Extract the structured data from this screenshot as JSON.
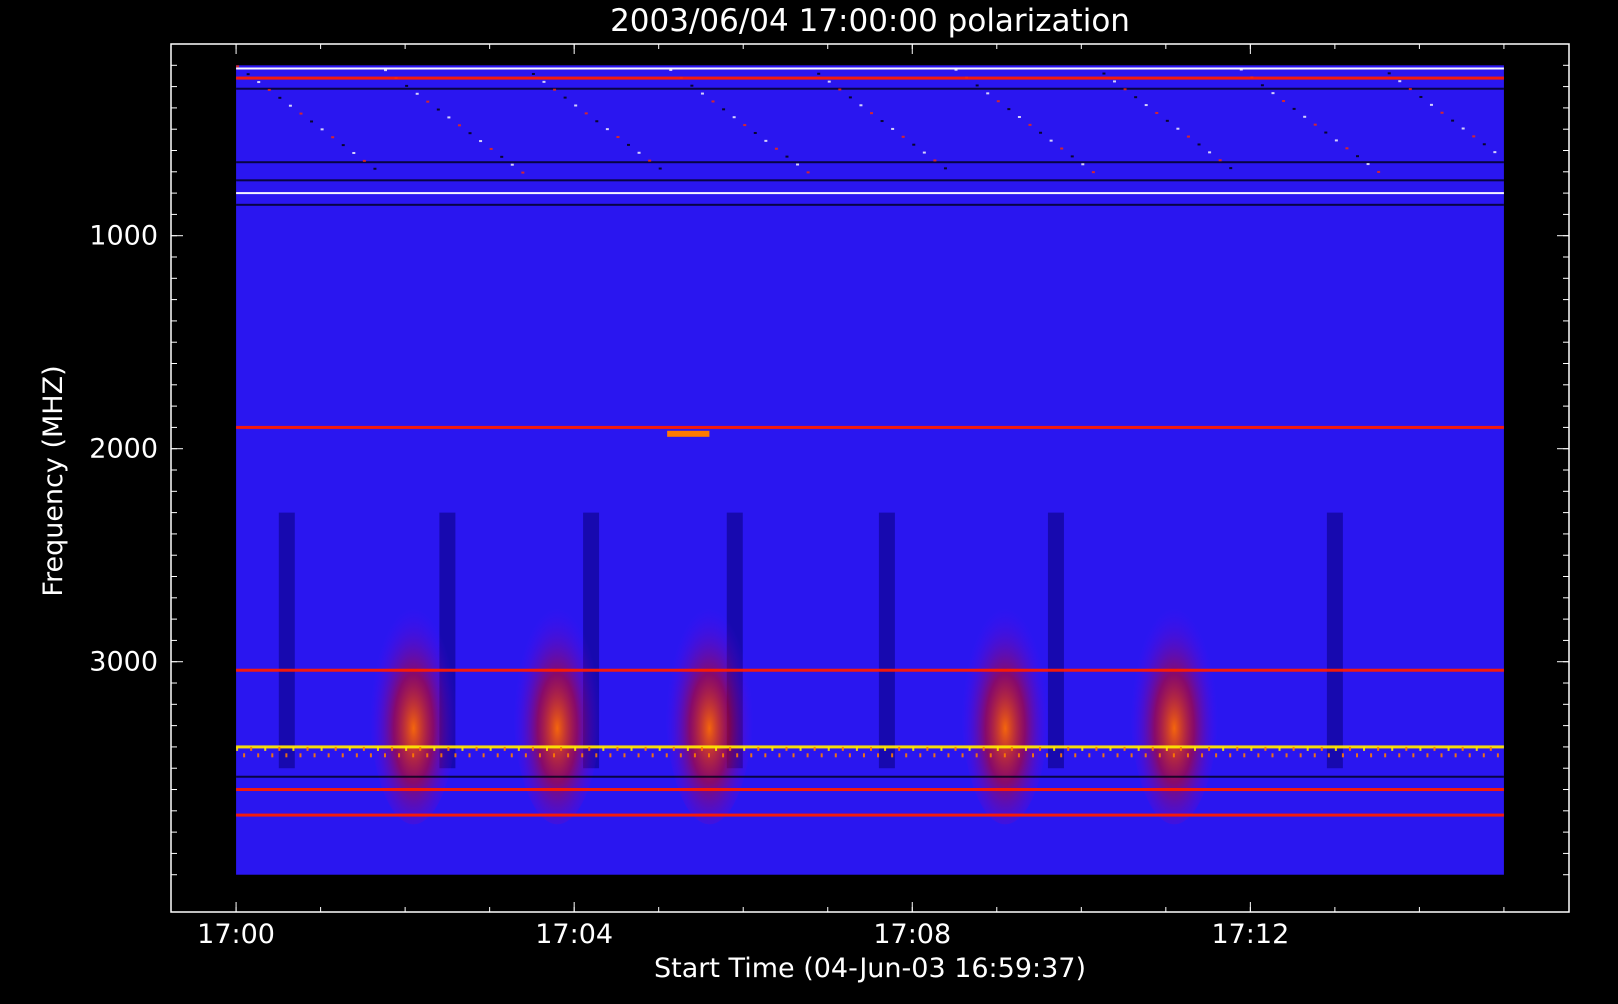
{
  "chart_data": {
    "type": "heatmap",
    "title": "2003/06/04 17:00:00 polarization",
    "xlabel": "Start Time (04-Jun-03 16:59:37)",
    "ylabel": "Frequency (MHZ)",
    "x_ticks": [
      "17:00",
      "17:04",
      "17:08",
      "17:12"
    ],
    "y_ticks": [
      1000,
      2000,
      3000
    ],
    "x_range_minutes_after_1700": [
      -0.77,
      15.77
    ],
    "y_range_mhz": [
      100,
      4175
    ],
    "data_x_range_minutes_after_1700": [
      0,
      15
    ],
    "data_y_range_mhz": [
      200,
      4000
    ],
    "colors": {
      "background": "#000000",
      "base": "#2a16f0",
      "dark": "#000018",
      "red": "#ff1a00",
      "orange": "#ff7a00",
      "yellow": "#ffe600",
      "frame": "#ffffff"
    },
    "features": {
      "horizontal_bands_mhz": [
        {
          "f": 215,
          "intensity": "white"
        },
        {
          "f": 260,
          "intensity": "red"
        },
        {
          "f": 310,
          "intensity": "dark"
        },
        {
          "f": 655,
          "intensity": "dark"
        },
        {
          "f": 740,
          "intensity": "dark"
        },
        {
          "f": 800,
          "intensity": "white"
        },
        {
          "f": 855,
          "intensity": "dark"
        },
        {
          "f": 1900,
          "intensity": "red"
        },
        {
          "f": 3040,
          "intensity": "red"
        },
        {
          "f": 3400,
          "intensity": "yellow"
        },
        {
          "f": 3540,
          "intensity": "dark"
        },
        {
          "f": 3600,
          "intensity": "red"
        },
        {
          "f": 3720,
          "intensity": "red"
        }
      ],
      "burst_times_min": [
        2.1,
        3.8,
        5.6,
        9.1,
        11.1
      ],
      "dark_stripe_times_min": [
        0.6,
        2.5,
        4.2,
        5.9,
        7.7,
        9.7,
        13.0
      ],
      "bright_spot": {
        "t_start": 5.1,
        "t_end": 5.6,
        "f": 1930
      }
    }
  }
}
